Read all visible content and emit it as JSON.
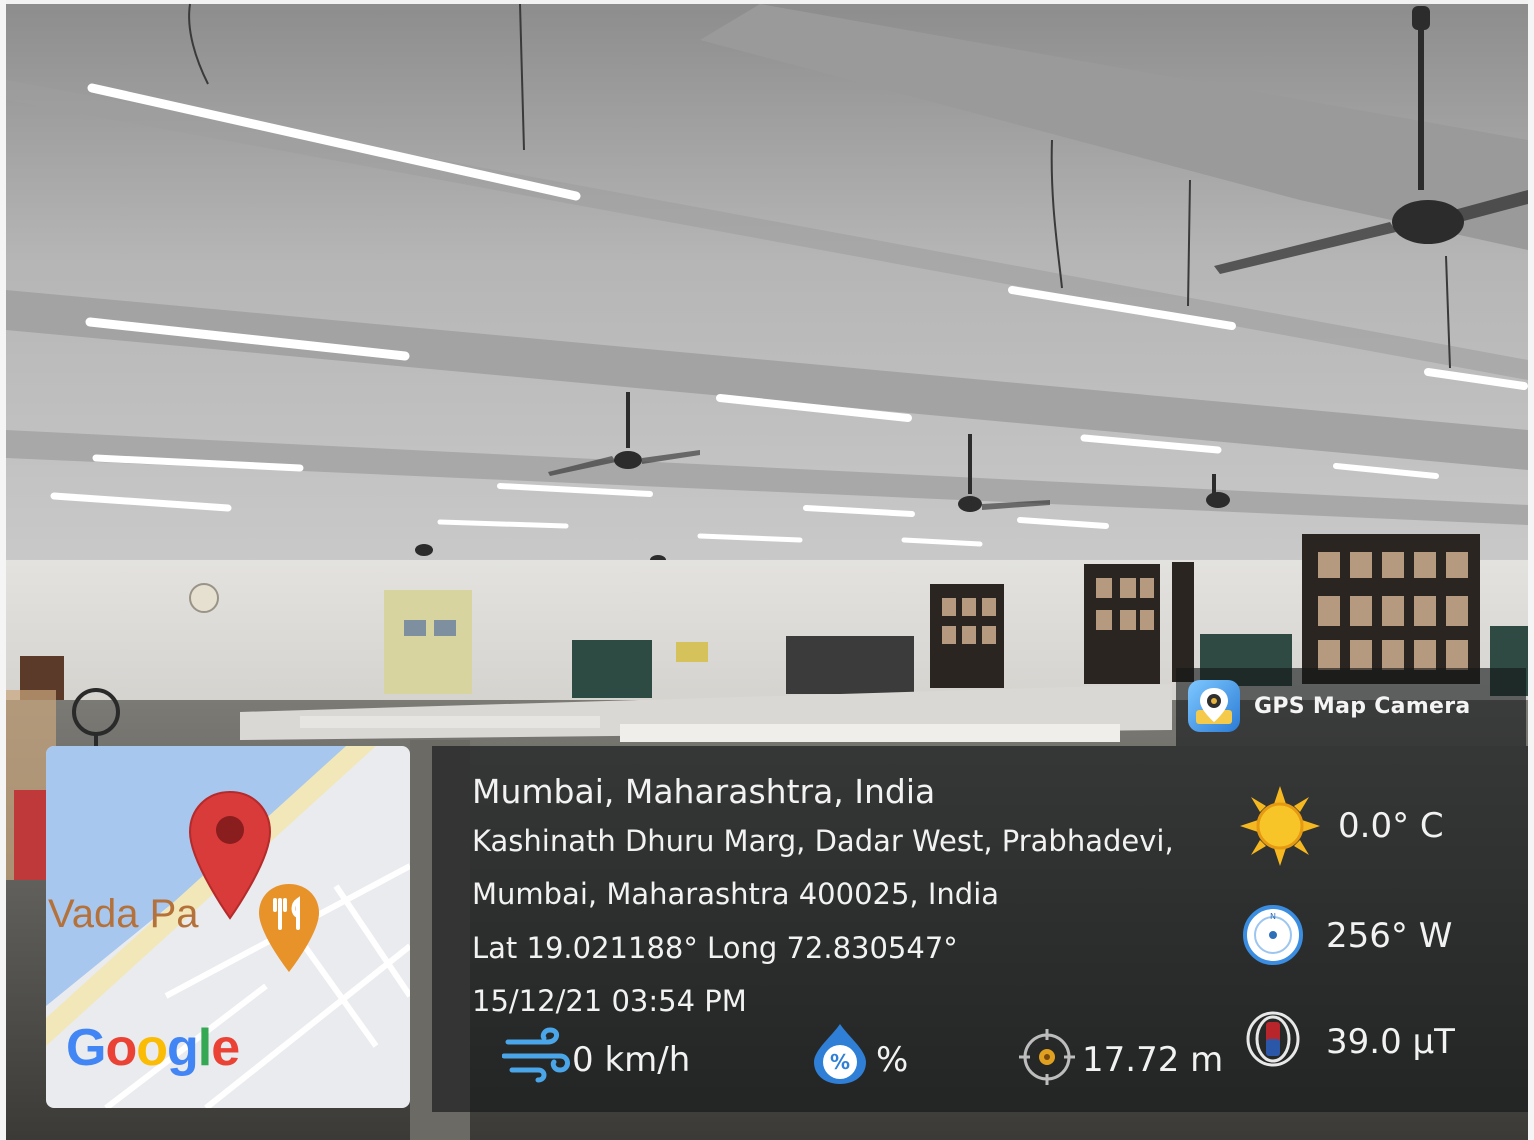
{
  "overlay": {
    "app_name": "GPS Map Camera",
    "address": {
      "city_line": "Mumbai, Maharashtra, India",
      "street_line": "Kashinath Dhuru Marg, Dadar West, Prabhadevi,",
      "postal_line": "Mumbai, Maharashtra 400025, India",
      "coordinates": "Lat 19.021188° Long 72.830547°",
      "datetime": "15/12/21 03:54 PM"
    },
    "metrics": {
      "temperature": "0.0° C",
      "heading": "256° W",
      "magnetic_field": "39.0 µT",
      "wind_speed": "0 km/h",
      "humidity": "%",
      "accuracy": "17.72 m"
    },
    "icons": {
      "temperature": "sun-icon",
      "heading": "compass-icon",
      "magnetic_field": "magnet-icon",
      "wind_speed": "wind-icon",
      "humidity": "humidity-drop-icon",
      "accuracy": "crosshair-icon",
      "app": "gps-map-camera-app-icon"
    },
    "map": {
      "place_label": "Vada Pa",
      "google_logo_text": "Google",
      "pin": "location-pin-icon",
      "poi": "restaurant-pin-icon"
    }
  },
  "colors": {
    "panel_bg": "#16181a",
    "overlay_text": "#f2f2f2",
    "map_pin": "#d93a3a",
    "poi_pin": "#e8922a",
    "sun": "#f6b820",
    "wind": "#4aa6e8",
    "humidity": "#2f7fd6"
  }
}
